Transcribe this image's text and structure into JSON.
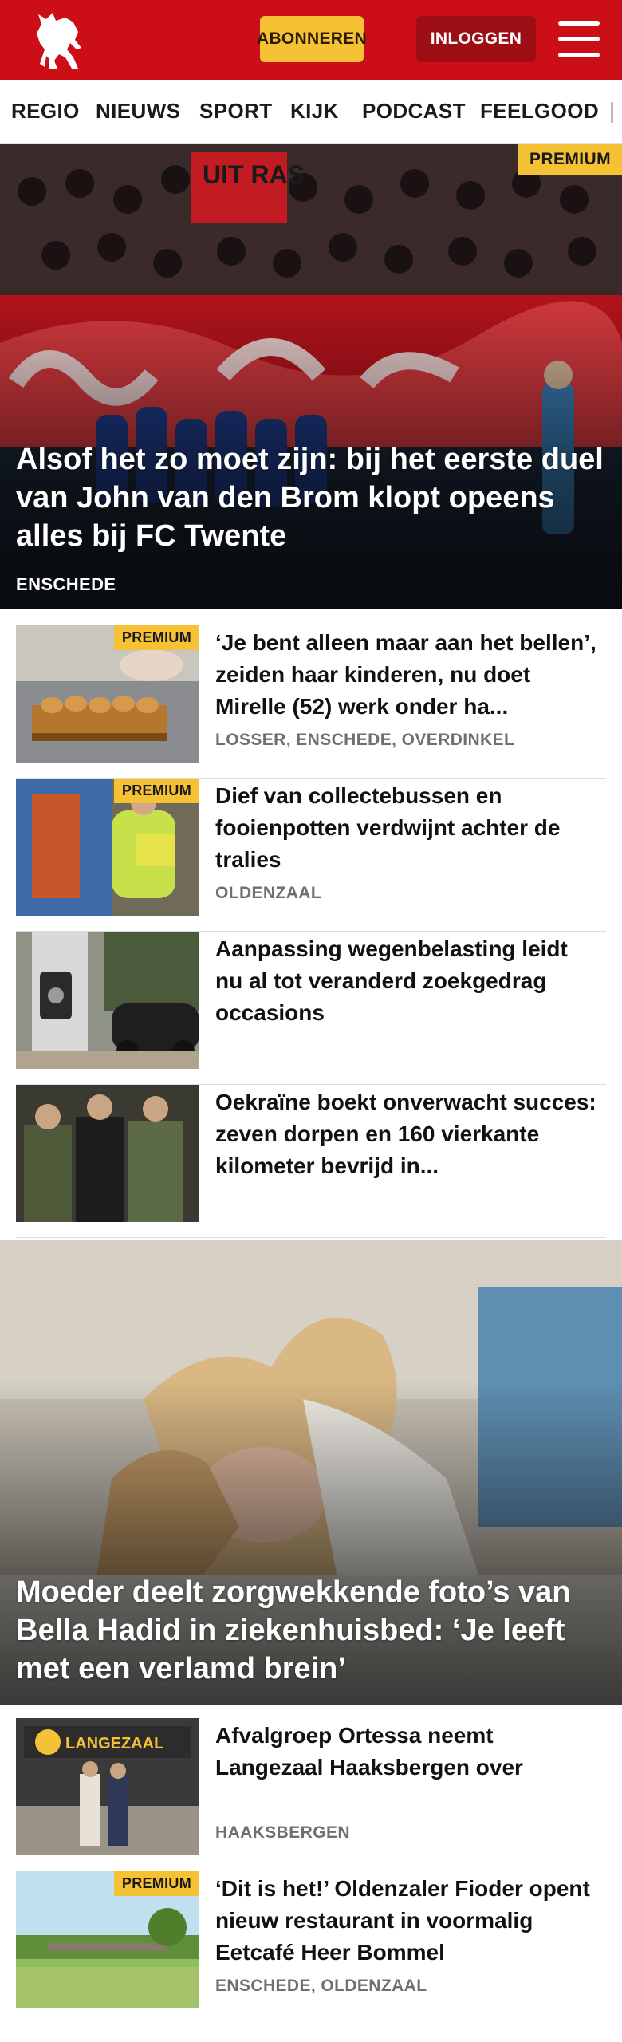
{
  "header": {
    "subscribe_label": "ABONNEREN",
    "login_label": "INLOGGEN"
  },
  "nav": {
    "items": [
      "REGIO",
      "NIEUWS",
      "SPORT",
      "KIJK",
      "PODCAST",
      "FEELGOOD"
    ]
  },
  "colors": {
    "brand_red": "#cc0f17",
    "premium_yellow": "#f5c135",
    "login_dark_red": "#9d0d14",
    "location_gray": "#6f6f6f"
  },
  "hero1": {
    "badge": "PREMIUM",
    "title": "Alsof het zo moet zijn: bij het eerste duel van John van den Brom klopt opeens alles bij FC Twente",
    "location": "ENSCHEDE",
    "banner_text": "UIT RAS"
  },
  "articles_a": [
    {
      "badge": "PREMIUM",
      "title": "‘Je bent alleen maar aan het bellen’, zeiden haar kinderen, nu doet Mirelle (52) werk onder ha...",
      "location": "LOSSER, ENSCHEDE, OVERDINKEL"
    },
    {
      "badge": "PREMIUM",
      "title": "Dief van collectebussen en fooienpotten verdwijnt achter de tralies",
      "location": "OLDENZAAL"
    },
    {
      "badge": "",
      "title": "Aanpassing wegenbelasting leidt nu al tot veranderd zoekgedrag occasions",
      "location": ""
    },
    {
      "badge": "",
      "title": "Oekraïne boekt onverwacht succes: zeven dorpen en 160 vierkante kilometer bevrijd in...",
      "location": ""
    }
  ],
  "hero2": {
    "title": "Moeder deelt zorgwekkende foto’s van Bella Hadid in ziekenhuisbed: ‘Je leeft met een verlamd brein’"
  },
  "articles_b": [
    {
      "badge": "",
      "title": "Afvalgroep Ortessa neemt Langezaal Haaksbergen over",
      "location": "HAAKSBERGEN",
      "sign_text": "LANGEZAAL"
    },
    {
      "badge": "PREMIUM",
      "title": "‘Dit is het!’ Oldenzaler Fioder opent nieuw restaurant in voormalig Eetcafé Heer Bommel",
      "location": "ENSCHEDE, OLDENZAAL"
    }
  ]
}
